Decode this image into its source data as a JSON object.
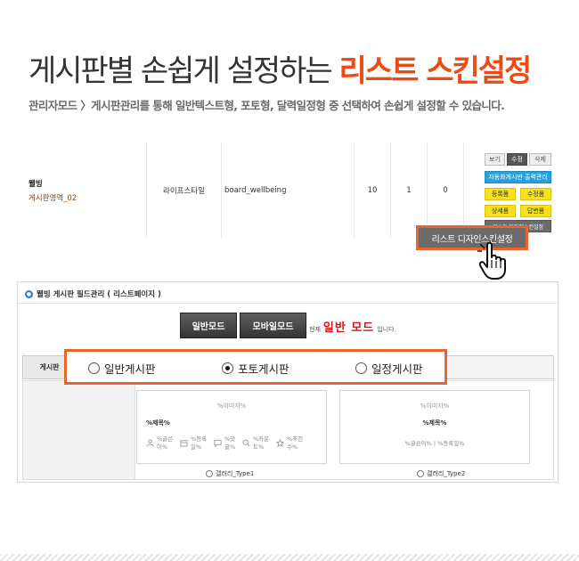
{
  "header": {
    "title_main": "게시판별 손쉽게 설정하는 ",
    "title_accent": "리스트 스킨설정",
    "subtitle": "관리자모드 〉게시판관리를 통해 일반텍스트형, 포토형, 달력일정형 중 선택하여 손쉽게 설정할 수 있습니다."
  },
  "board_row": {
    "name": "웰빙",
    "category": "게시판영역_02",
    "skin": "라이프스타일",
    "board_id": "board_wellbeing",
    "num1": "10",
    "num2": "1",
    "num3": "0",
    "buttons": {
      "view": "보기",
      "edit": "수정",
      "delete": "삭제",
      "auto_output": "자동화게시판 출력관리",
      "register": "등록폼",
      "modify_form": "수정폼",
      "detail": "상세폼",
      "reply": "답변폼",
      "list_design_small": "리스트 디자인스킨설정"
    },
    "highlight_button": "리스트 디자인스킨설정"
  },
  "panel": {
    "title": "웰빙 게시판 필드관리 ( 리스트페이지 )",
    "mode_general": "일반모드",
    "mode_mobile": "모바일모드",
    "current_prefix": "현재",
    "current_mode": "일반 모드",
    "current_suffix": "입니다.",
    "tab_first": "게시판",
    "card1": {
      "image": "%이미지%",
      "title": "%제목%",
      "meta_author": "%글쓴이%",
      "meta_date": "%등록일%",
      "meta_comment": "%덧글%",
      "meta_hits": "%카운트%",
      "meta_recommend": "%추천수%"
    },
    "card2": {
      "image": "%이미지%",
      "title": "%제목%",
      "meta": "%글쓴이% | %등록일%"
    },
    "type1": "갤러리_Type1",
    "type2": "갤러리_Type2"
  },
  "callout": {
    "options": [
      "일반게시판",
      "포토게시판",
      "일정게시판"
    ],
    "selected": "포토게시판"
  },
  "colors": {
    "accent": "#ee4a16",
    "callout_border": "#e8662e",
    "current_mode": "#d4131a"
  }
}
